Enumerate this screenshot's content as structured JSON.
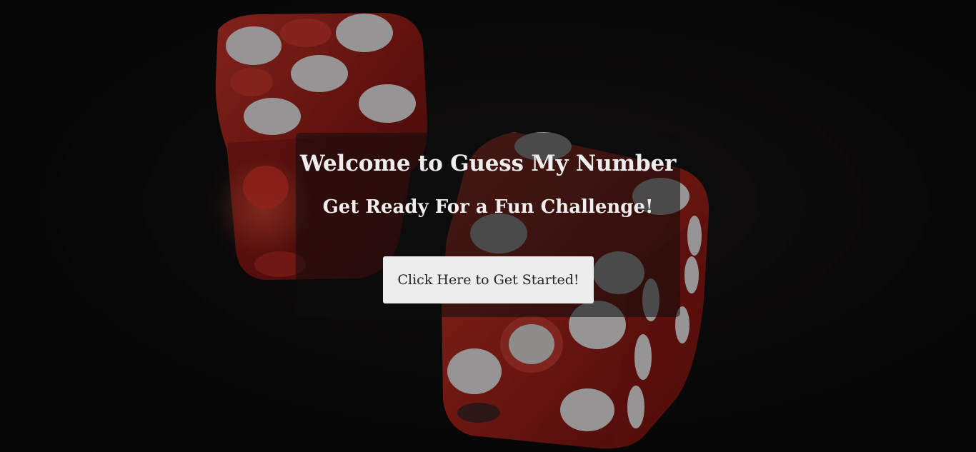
{
  "hero": {
    "title": "Welcome to Guess My Number",
    "subtitle": "Get Ready For a Fun Challenge!",
    "start_button_label": "Click Here to Get Started!"
  },
  "background": {
    "image": "red-dice-icon",
    "dice_color": "#b3261e",
    "pip_color": "#e6e6e6",
    "backdrop_color": "#0e0d0e"
  }
}
